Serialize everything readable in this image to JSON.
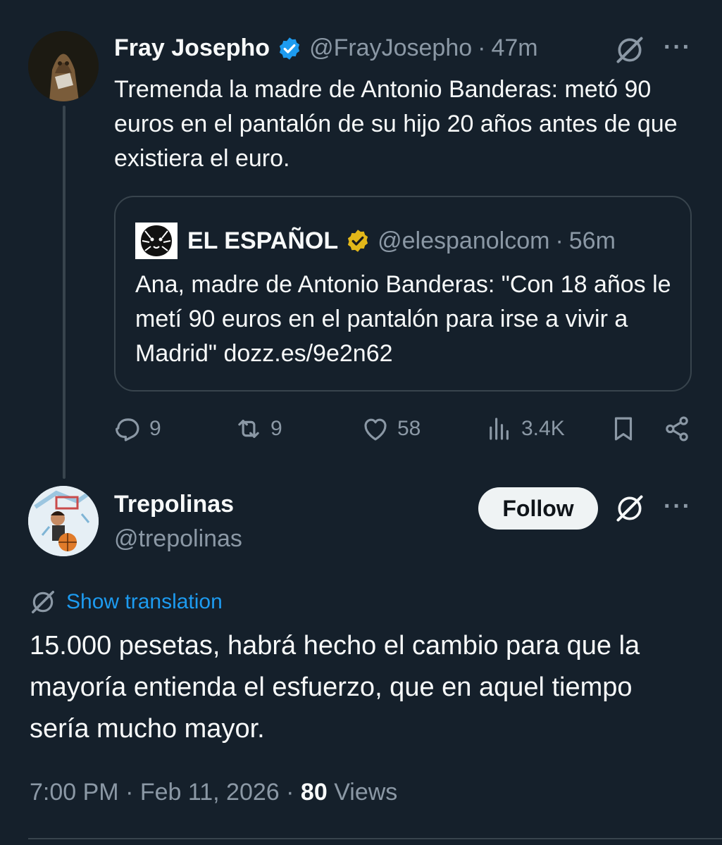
{
  "tweet": {
    "author_name": "Fray Josepho",
    "handle": "@FrayJosepho",
    "separator": "·",
    "time": "47m",
    "text": "Tremenda la madre de Antonio Banderas: metó 90 euros en el pantalón de su hijo 20 años antes de que existiera el euro."
  },
  "quote": {
    "author_name": "EL ESPAÑOL",
    "handle": "@elespanolcom",
    "separator": "·",
    "time": "56m",
    "text": "Ana, madre de Antonio Banderas: \"Con 18 años le metí 90 euros en el pantalón para irse a vivir a Madrid\" dozz.es/9e2n62"
  },
  "actions": {
    "replies": "9",
    "reposts": "9",
    "likes": "58",
    "views": "3.4K"
  },
  "reply": {
    "author_name": "Trepolinas",
    "handle": "@trepolinas",
    "follow_label": "Follow",
    "show_translation": "Show translation",
    "text": "15.000 pesetas, habrá hecho el cambio para que la mayoría entienda el esfuerzo, que en aquel tiempo sería mucho mayor.",
    "timestamp": "7:00 PM · Feb 11, 2026 ·",
    "views_count": "80",
    "views_label": "Views"
  },
  "more_glyph": "···",
  "colors": {
    "background": "#15202b",
    "text": "#f7f9f9",
    "muted": "#8b98a5",
    "link": "#1d9bf0",
    "verified_blue": "#1d9bf0",
    "verified_gold": "#e2b719",
    "border": "#38444d"
  }
}
